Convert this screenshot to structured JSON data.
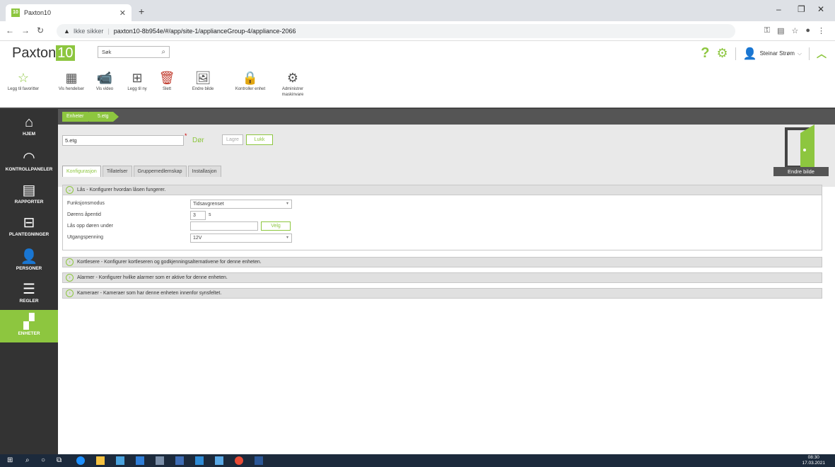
{
  "browser": {
    "tab_title": "Paxton10",
    "favicon_text": "10",
    "new_tab": "+",
    "insecure_label": "Ikke sikker",
    "url": "paxton10-8b954e/#/app/site-1/applianceGroup-4/appliance-2066"
  },
  "header": {
    "logo_text": "Paxton",
    "logo_number": "10",
    "search_placeholder": "Søk",
    "help": "?",
    "user_name": "Steinar Strøm"
  },
  "toolbar": {
    "favorites": "Legg til favoritter",
    "events": "Vis hendelser",
    "video": "Vis video",
    "add_new": "Legg til ny",
    "delete": "Slett",
    "change_image": "Endre bilde",
    "control_device": "Kontroller enhet",
    "manage_hw_1": "Administrer",
    "manage_hw_2": "maskinvare"
  },
  "nav": {
    "home": "HJEM",
    "dashboards": "KONTROLLPANELER",
    "reports": "RAPPORTER",
    "floorplans": "PLANTEGNINGER",
    "people": "PERSONER",
    "rules": "REGLER",
    "devices": "ENHETER"
  },
  "breadcrumb": {
    "root": "Enheter",
    "current": "5.etg"
  },
  "device": {
    "name": "5.etg",
    "required_mark": "*",
    "type": "Dør",
    "save": "Lagre",
    "close": "Lukk",
    "change_picture": "Endre bilde"
  },
  "tabs": {
    "config": "Konfigurasjon",
    "permissions": "Tillatelser",
    "group_membership": "Gruppemedlemskap",
    "installation": "Installasjon"
  },
  "lock_panel": {
    "title": "Lås - Konfigurer hvordan låsen fungerer.",
    "mode_label": "Funksjonsmodus",
    "mode_value": "Tidsavgrenset",
    "open_time_label": "Dørens åpentid",
    "open_time_value": "3",
    "open_time_unit": "s",
    "unlock_label": "Lås opp døren under",
    "unlock_value": "",
    "choose": "Velg",
    "voltage_label": "Utgangspenning",
    "voltage_value": "12V"
  },
  "panels": {
    "readers": "Kortlesere - Konfigurer kortleseren og godkjenningsalternativene for denne enheten.",
    "alarms": "Alarmer - Konfigurer hvilke alarmer som er aktive for denne enheten.",
    "cameras": "Kameraer - Kameraer som har denne enheten innenfor synsfeltet."
  },
  "taskbar": {
    "time": "08:30",
    "date": "17.03.2021"
  },
  "colors": {
    "accent": "#8dc63f",
    "nav_bg": "#333333"
  }
}
